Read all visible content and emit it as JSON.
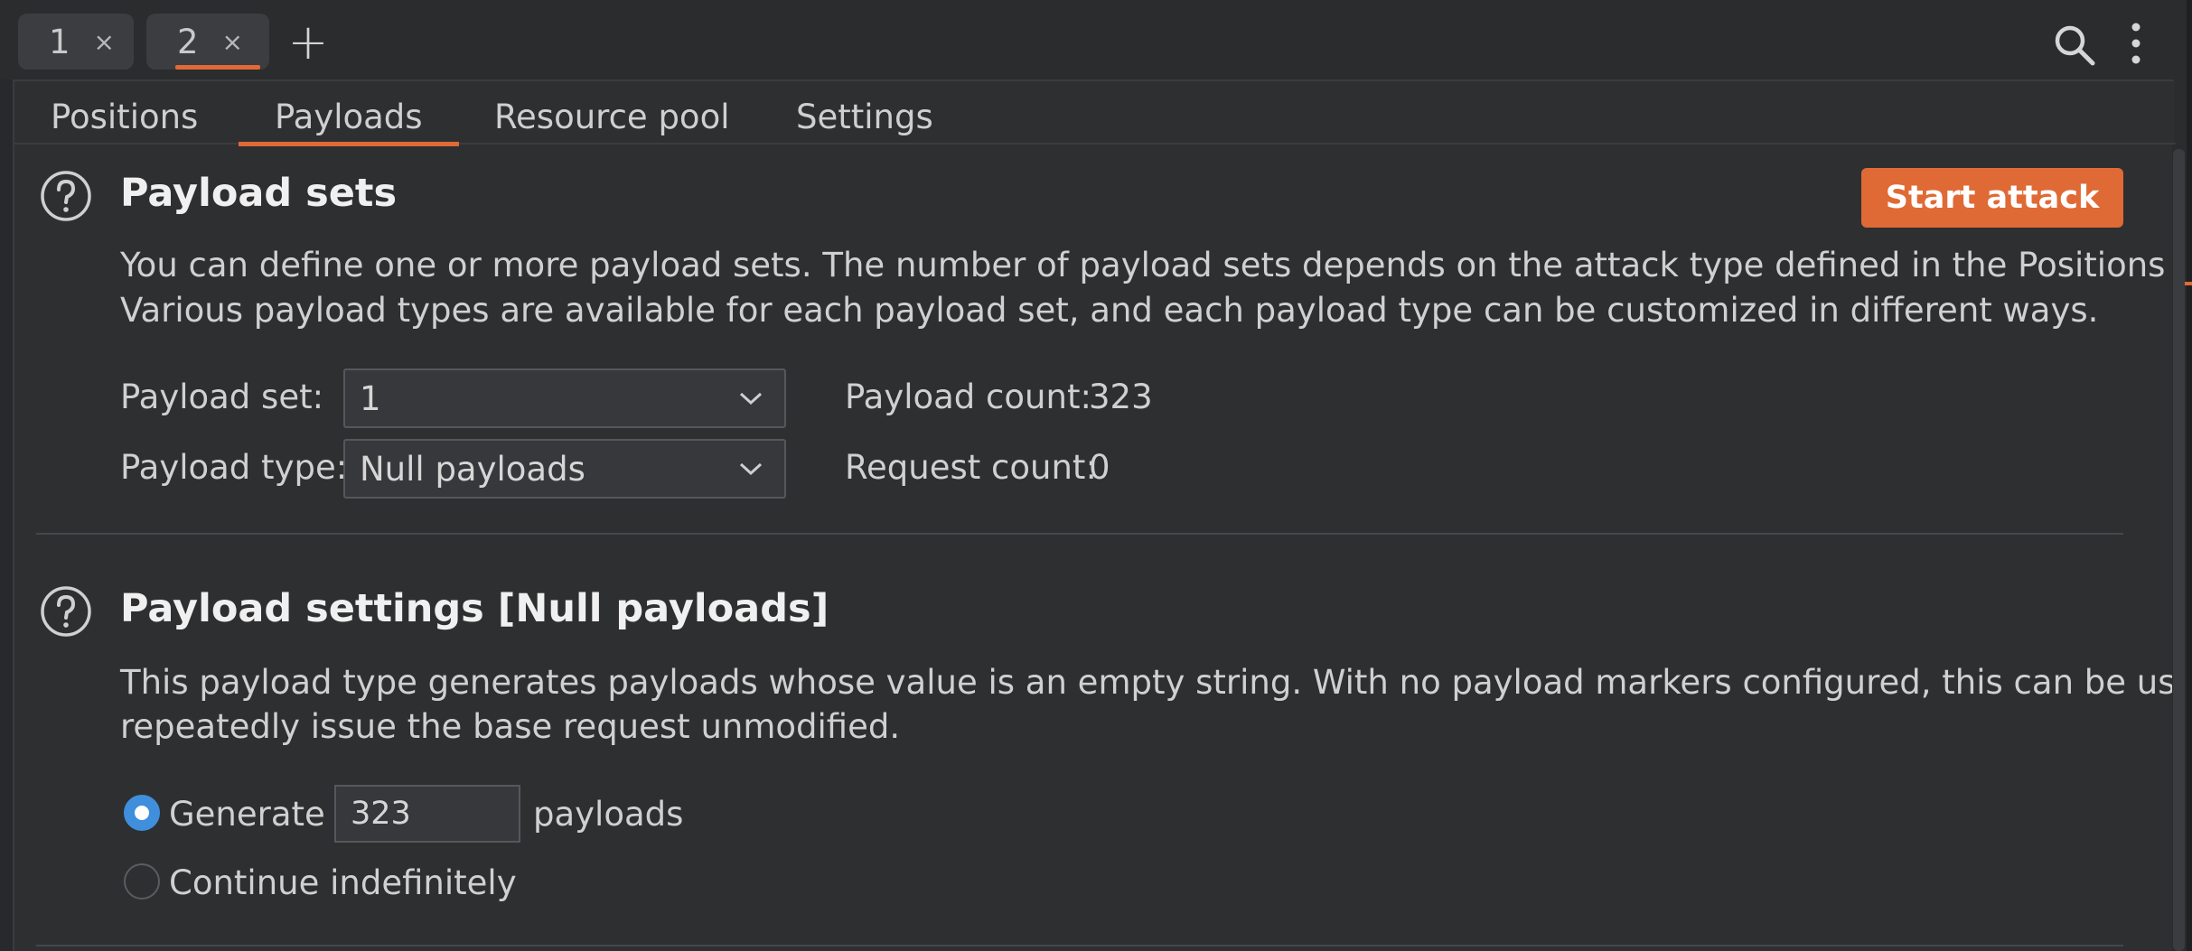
{
  "top_tabs": [
    {
      "label": "1",
      "close": "×",
      "active": false
    },
    {
      "label": "2",
      "close": "×",
      "active": true
    }
  ],
  "add_tab_label": "+",
  "icons": {
    "search": "search-icon",
    "more": "more-vertical-icon",
    "help": "help-circle-icon",
    "chevron": "chevron-down-icon"
  },
  "subtabs": [
    {
      "label": "Positions",
      "active": false
    },
    {
      "label": "Payloads",
      "active": true
    },
    {
      "label": "Resource pool",
      "active": false
    },
    {
      "label": "Settings",
      "active": false
    }
  ],
  "payload_sets": {
    "title": "Payload sets",
    "start_attack_label": "Start attack",
    "description_line1": "You can define one or more payload sets. The number of payload sets depends on the attack type defined in the Positions tab.",
    "description_line2": "Various payload types are available for each payload set, and each payload type can be customized in different ways.",
    "payload_set_label": "Payload set:",
    "payload_set_value": "1",
    "payload_type_label": "Payload type:",
    "payload_type_value": "Null payloads",
    "payload_count_label": "Payload count:",
    "payload_count_value": "323",
    "request_count_label": "Request count:",
    "request_count_value": "0"
  },
  "payload_settings": {
    "title": "Payload settings [Null payloads]",
    "description_line1": "This payload type generates payloads whose value is an empty string. With no payload markers configured, this can be used to",
    "description_line2": "repeatedly issue the base request unmodified.",
    "generate_label": "Generate",
    "generate_count": "323",
    "payloads_suffix": "payloads",
    "continue_label": "Continue indefinitely",
    "selected_option": "Generate"
  },
  "colors": {
    "accent": "#e06a35",
    "radio_selected": "#3f8fdc",
    "background": "#2e2f31"
  }
}
